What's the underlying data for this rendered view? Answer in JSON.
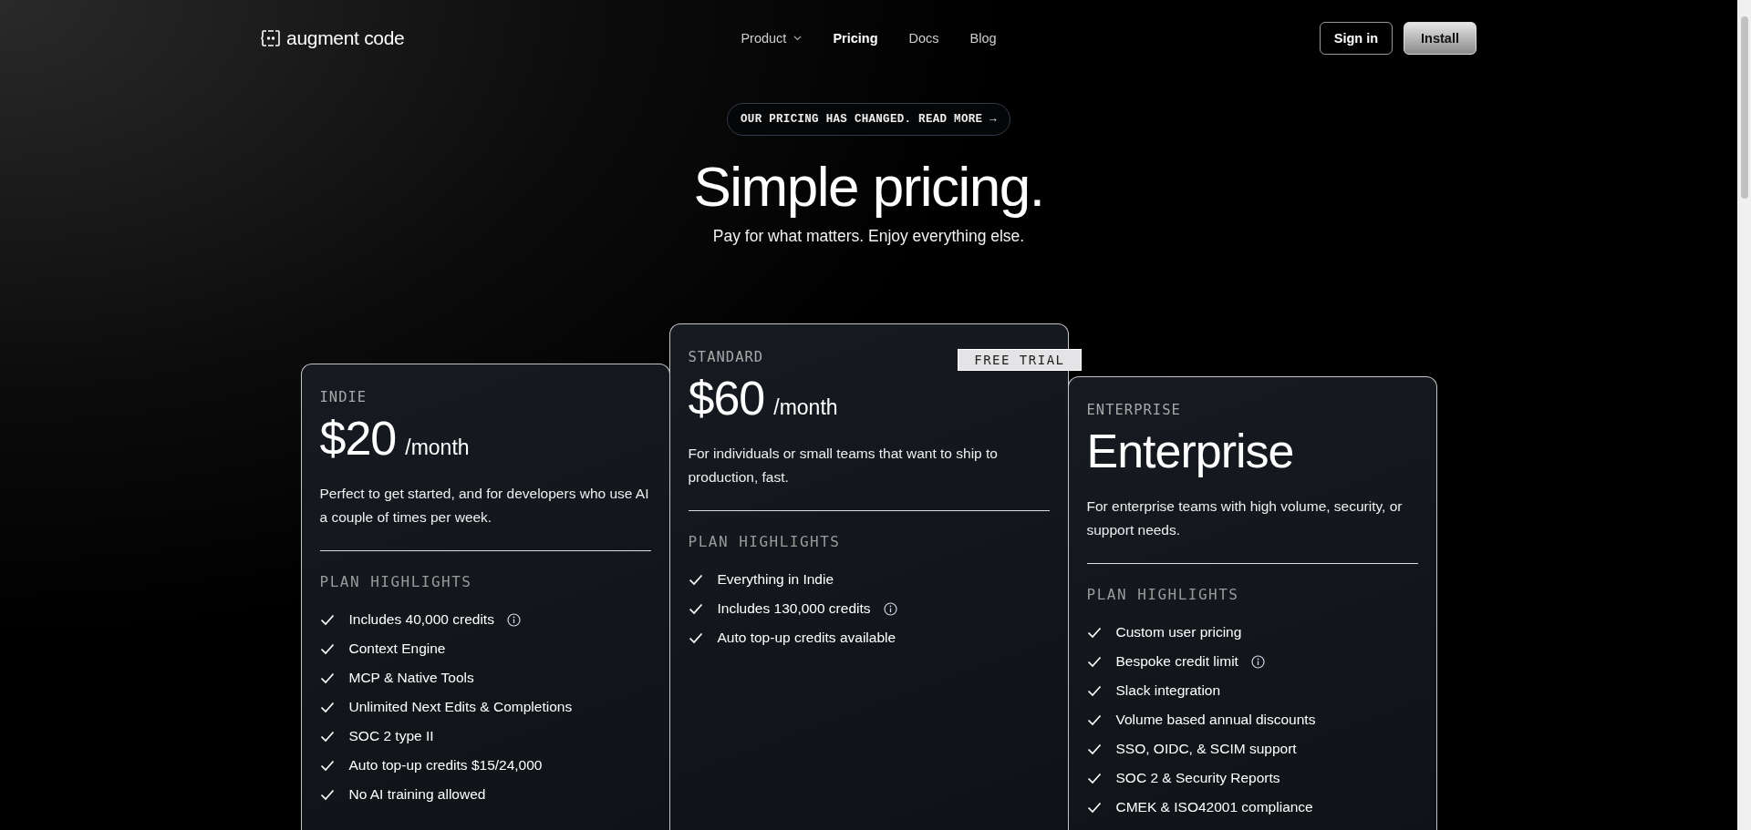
{
  "nav": {
    "logo": "augment code",
    "links": [
      {
        "label": "Product",
        "dropdown": true,
        "selected": false
      },
      {
        "label": "Pricing",
        "dropdown": false,
        "selected": true
      },
      {
        "label": "Docs",
        "dropdown": false,
        "selected": false
      },
      {
        "label": "Blog",
        "dropdown": false,
        "selected": false
      }
    ],
    "buttons": [
      {
        "label": "Sign in",
        "kind": "outline"
      },
      {
        "label": "Install",
        "kind": "filled"
      }
    ]
  },
  "announcement": "OUR PRICING HAS CHANGED. READ MORE →",
  "hero": {
    "title": "Simple pricing.",
    "subtitle": "Pay for what matters. Enjoy everything else."
  },
  "plans": [
    {
      "tier": "INDIE",
      "price": "$20",
      "period": "/month",
      "description": "Perfect to get started, and for developers who use AI a couple of times per week.",
      "highlights_title": "PLAN HIGHLIGHTS",
      "highlights": [
        {
          "text": "Includes 40,000 credits",
          "info": true
        },
        {
          "text": "Context Engine",
          "info": false
        },
        {
          "text": "MCP & Native Tools",
          "info": false
        },
        {
          "text": "Unlimited Next Edits & Completions",
          "info": false
        },
        {
          "text": "SOC 2 type II",
          "info": false
        },
        {
          "text": "Auto top-up credits $15/24,000",
          "info": false
        },
        {
          "text": "No AI training allowed",
          "info": false
        }
      ]
    },
    {
      "tier": "STANDARD",
      "badge": "FREE TRIAL",
      "price": "$60",
      "period": "/month",
      "description": "For individuals or small teams that want to ship to production, fast.",
      "highlights_title": "PLAN HIGHLIGHTS",
      "highlights": [
        {
          "text": "Everything in Indie",
          "info": false
        },
        {
          "text": "Includes 130,000 credits",
          "info": true
        },
        {
          "text": "Auto top-up credits available",
          "info": false
        }
      ]
    },
    {
      "tier": "ENTERPRISE",
      "price": "Enterprise",
      "description": "For enterprise teams with high volume, security, or support needs.",
      "highlights_title": "PLAN HIGHLIGHTS",
      "highlights": [
        {
          "text": "Custom user pricing",
          "info": false
        },
        {
          "text": "Bespoke credit limit",
          "info": true
        },
        {
          "text": "Slack integration",
          "info": false
        },
        {
          "text": "Volume based annual discounts",
          "info": false
        },
        {
          "text": "SSO, OIDC, & SCIM support",
          "info": false
        },
        {
          "text": "SOC 2 & Security Reports",
          "info": false
        },
        {
          "text": "CMEK & ISO42001 compliance",
          "info": false
        }
      ]
    }
  ]
}
